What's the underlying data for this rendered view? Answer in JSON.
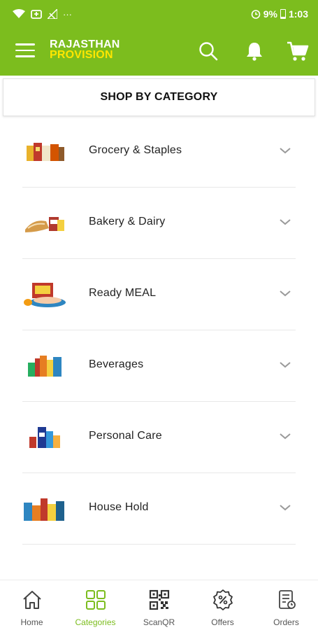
{
  "status_bar": {
    "battery": "9%",
    "time": "1:03",
    "more": "···"
  },
  "app": {
    "brand_line1": "RAJASTHAN",
    "brand_line2": "PROVISION"
  },
  "colors": {
    "primary": "#7cbd1e",
    "brand_yellow": "#ffe600",
    "active_nav": "#7cbd1e"
  },
  "header": {
    "title": "SHOP BY CATEGORY"
  },
  "categories": [
    {
      "label": "Grocery & Staples",
      "icon": "grocery-thumbnail"
    },
    {
      "label": "Bakery & Dairy",
      "icon": "bakery-thumbnail"
    },
    {
      "label": "Ready MEAL",
      "icon": "ready-meal-thumbnail"
    },
    {
      "label": "Beverages",
      "icon": "beverages-thumbnail"
    },
    {
      "label": "Personal Care",
      "icon": "personal-care-thumbnail"
    },
    {
      "label": "House Hold",
      "icon": "household-thumbnail"
    }
  ],
  "bottom_nav": [
    {
      "label": "Home",
      "icon": "home-icon",
      "active": false
    },
    {
      "label": "Categories",
      "icon": "categories-icon",
      "active": true
    },
    {
      "label": "ScanQR",
      "icon": "qr-icon",
      "active": false
    },
    {
      "label": "Offers",
      "icon": "offers-icon",
      "active": false
    },
    {
      "label": "Orders",
      "icon": "orders-icon",
      "active": false
    }
  ]
}
